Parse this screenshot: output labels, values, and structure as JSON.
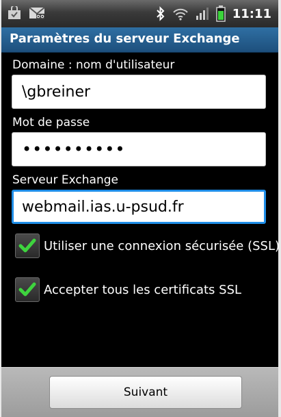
{
  "status_bar": {
    "left_icons": [
      "shopping-bag-notification-icon",
      "voicemail-icon"
    ],
    "right_icons": [
      "bluetooth-icon",
      "wifi-icon",
      "signal-icon",
      "battery-icon"
    ],
    "time": "11:11"
  },
  "title_bar": {
    "title": "Paramètres du serveur Exchange"
  },
  "form": {
    "domain_label": "Domaine : nom d'utilisateur",
    "domain_value": "\\gbreiner",
    "password_label": "Mot de passe",
    "password_value": "••••••••••",
    "server_label": "Serveur Exchange",
    "server_value": "webmail.ias.u-psud.fr",
    "ssl_checkbox": {
      "label": "Utiliser une connexion sécurisée (SSL)",
      "checked": true
    },
    "certs_checkbox": {
      "label": "Accepter tous les certificats SSL",
      "checked": true
    }
  },
  "footer": {
    "next_label": "Suivant"
  },
  "colors": {
    "title_bar": "#1d4f7c",
    "focus_border": "#1f8ee8",
    "check_green": "#3ed43e"
  }
}
